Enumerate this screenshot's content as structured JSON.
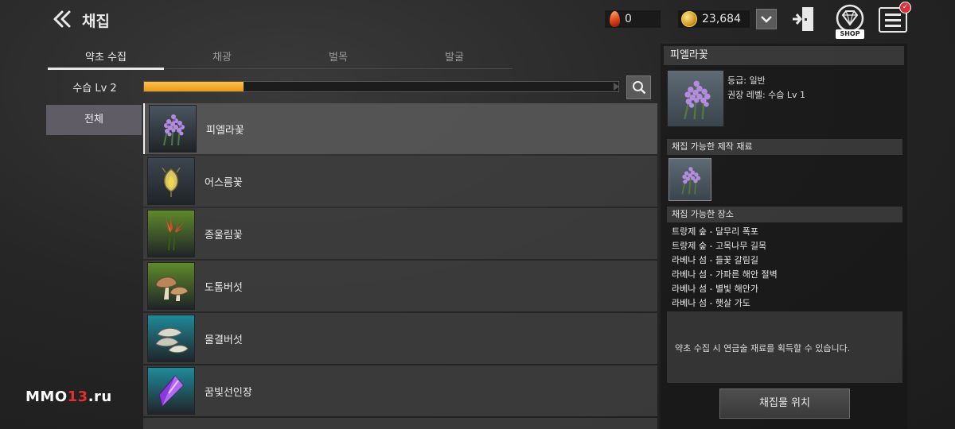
{
  "header": {
    "title": "채집",
    "currency_red": "0",
    "currency_gold": "23,684",
    "shop_label": "SHOP",
    "menu_badge": "✓"
  },
  "tabs": [
    {
      "label": "약초 수집",
      "active": true
    },
    {
      "label": "채광",
      "active": false
    },
    {
      "label": "벌목",
      "active": false
    },
    {
      "label": "발굴",
      "active": false
    }
  ],
  "level": {
    "label": "수습 Lv 2",
    "progress": 0.21
  },
  "category": {
    "label": "전체"
  },
  "items": [
    {
      "name": "피엘라꽃",
      "icon": "lavender-flower-icon",
      "bg": "#4a5660",
      "selected": true
    },
    {
      "name": "어스름꽃",
      "icon": "dusk-flower-icon",
      "bg": "#3c4650",
      "selected": false
    },
    {
      "name": "종울림꽃",
      "icon": "bell-flower-icon",
      "bg": "#5e8a2a",
      "selected": false
    },
    {
      "name": "도톰버섯",
      "icon": "mushroom-icon",
      "bg": "#5e8a2a",
      "selected": false
    },
    {
      "name": "물결버섯",
      "icon": "wave-mushroom-icon",
      "bg": "#1f8a9a",
      "selected": false
    },
    {
      "name": "꿈빛선인장",
      "icon": "crystal-icon",
      "bg": "#1f8a9a",
      "selected": false
    }
  ],
  "detail": {
    "title": "피엘라꽃",
    "grade": "등급: 일반",
    "level": "권장 레벨: 수습 Lv 1",
    "materials_header": "채집 가능한 제작 재료",
    "locations_header": "채집 가능한 장소",
    "locations": [
      "트랑제 숲 - 달무리 폭포",
      "트랑제 숲 - 고목나무 길목",
      "라베나 섬 - 들꽃 갈림길",
      "라베나 섬 - 가파른 해안 절벽",
      "라베나 섬 - 별빛 해안가",
      "라베나 섬 - 햇살 가도"
    ],
    "description": "약초 수집 시 연금술 재료를 획득할 수 있습니다.",
    "button_label": "채집물 위치"
  },
  "watermark": {
    "prefix": "MMO",
    "number": "13",
    "suffix": ".ru"
  },
  "colors": {
    "progress": "#f2ae2a",
    "category_bg": "#5f5c66",
    "badge": "#d8323a"
  }
}
